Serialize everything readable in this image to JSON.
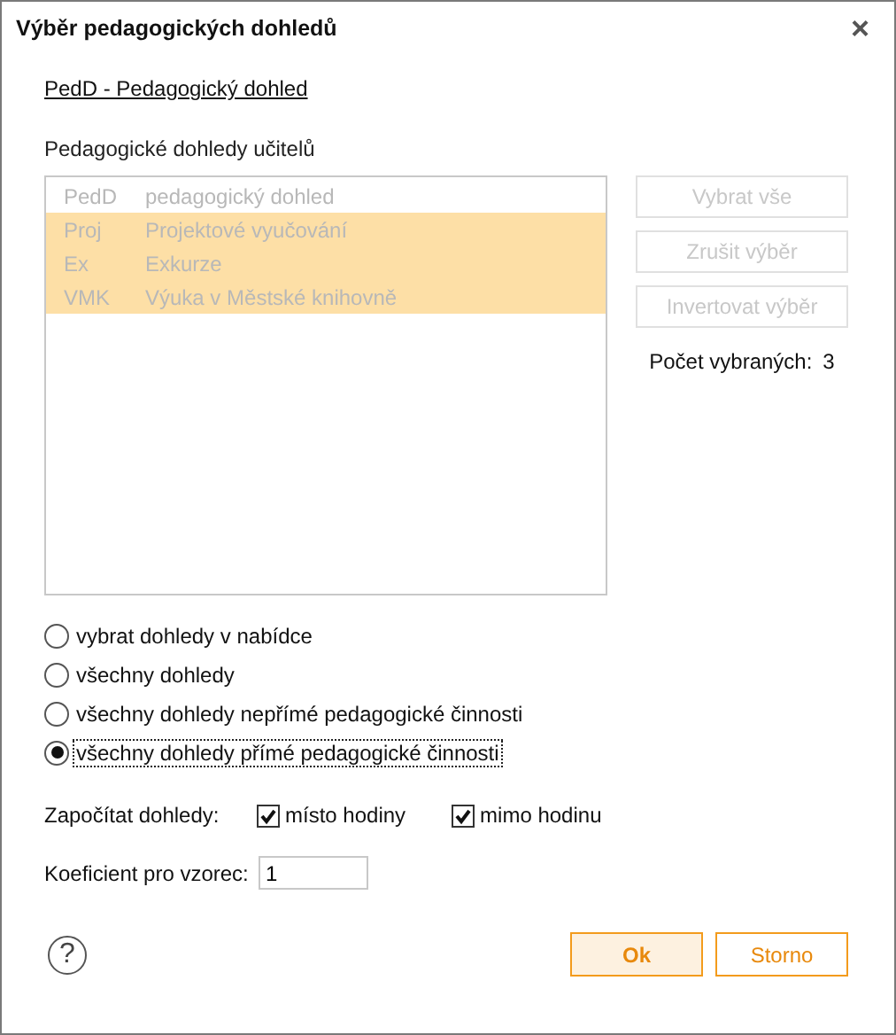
{
  "window": {
    "title": "Výběr pedagogických dohledů",
    "close": "×"
  },
  "link": "PedD - Pedagogický dohled",
  "list": {
    "label": "Pedagogické dohledy učitelů",
    "disabled": true,
    "rows": [
      {
        "code": "PedD",
        "name": "pedagogický dohled",
        "selected": false
      },
      {
        "code": "Proj",
        "name": "Projektové vyučování",
        "selected": true
      },
      {
        "code": "Ex",
        "name": "Exkurze",
        "selected": true
      },
      {
        "code": "VMK",
        "name": "Výuka v Městské knihovně",
        "selected": true
      }
    ]
  },
  "side_buttons": [
    {
      "label": "Vybrat vše",
      "disabled": true
    },
    {
      "label": "Zrušit výběr",
      "disabled": true
    },
    {
      "label": "Invertovat výběr",
      "disabled": true
    }
  ],
  "count": {
    "label": "Počet vybraných:",
    "value": "3"
  },
  "radios": [
    {
      "label": "vybrat dohledy v nabídce",
      "selected": false
    },
    {
      "label": "všechny dohledy",
      "selected": false
    },
    {
      "label": "všechny dohledy nepřímé pedagogické činnosti",
      "selected": false
    },
    {
      "label": "všechny dohledy přímé pedagogické činnosti",
      "selected": true
    }
  ],
  "count_in": {
    "label": "Započítat dohledy:",
    "options": [
      {
        "label": "místo hodiny",
        "checked": true
      },
      {
        "label": "mimo hodinu",
        "checked": true
      }
    ]
  },
  "coefficient": {
    "label": "Koeficient pro vzorec:",
    "value": "1"
  },
  "help": "?",
  "buttons": [
    {
      "label": "Ok",
      "kind": "primary"
    },
    {
      "label": "Storno",
      "kind": "secondary"
    }
  ]
}
